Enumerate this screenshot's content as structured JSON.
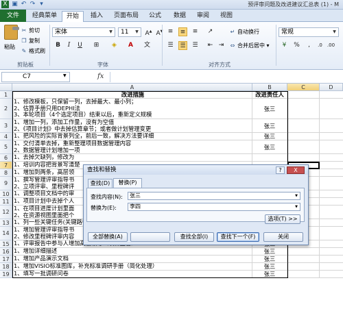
{
  "window": {
    "title": "预评审问题及改进建议汇总表 (1) - M"
  },
  "ribbon": {
    "tabs": [
      "文件",
      "经典菜单",
      "开始",
      "插入",
      "页面布局",
      "公式",
      "数据",
      "审阅",
      "视图"
    ],
    "active_tab": "开始",
    "clipboard": {
      "paste": "粘贴",
      "cut": "剪切",
      "copy": "复制",
      "format_painter": "格式刷",
      "group_label": "剪贴板"
    },
    "font": {
      "font_name": "宋体",
      "font_size": "11",
      "group_label": "字体"
    },
    "alignment": {
      "wrap_text": "自动换行",
      "merge_center": "合并后居中",
      "group_label": "对齐方式"
    },
    "number": {
      "format": "常规"
    }
  },
  "formula_bar": {
    "name_box": "C7",
    "fx": "fx",
    "content": ""
  },
  "grid": {
    "columns": [
      "A",
      "B",
      "C",
      "D"
    ],
    "header_row": {
      "num": "1",
      "a": "改进措施",
      "b": "改进责任人"
    },
    "rows": [
      {
        "num": "2",
        "lines": [
          "1、修改模板，只保留一列，去掉最大、最小列；",
          "2、估算手册只用DEPHI法",
          "3、本轮项目（4个选定项目）结束以后，重新定义规模"
        ],
        "b": "张三"
      },
      {
        "num": "3",
        "lines": [
          "1、增加一列，添加工作量，没有为空值",
          "2、《项目计划》中去掉估算章节；或者做计划管理变更"
        ],
        "b": "张三"
      },
      {
        "num": "4",
        "lines": [
          "1、把风险的实际背景列全，前后一致，解决方法要详细"
        ],
        "b": "张三"
      },
      {
        "num": "5",
        "lines": [
          "1、交付清单去掉，重新整理项目数据管理内容",
          "2、数据管理计划增加一项"
        ],
        "b": "张三"
      },
      {
        "num": "6",
        "lines": [
          "1、去掉欠缺列，修改为"
        ],
        "b": ""
      },
      {
        "num": "7",
        "lines": [
          "1、培训内容把背景写清楚"
        ],
        "b": ""
      },
      {
        "num": "8",
        "lines": [
          "1、增加到两条，高层领"
        ],
        "b": ""
      },
      {
        "num": "9",
        "lines": [
          "1、撰写管理评审指导书",
          "2、立项评审、里程碑评"
        ],
        "b": ""
      },
      {
        "num": "10",
        "lines": [
          "1、调整项目文档中的审"
        ],
        "b": ""
      },
      {
        "num": "11",
        "lines": [
          "1、项目计划中去掉个人"
        ],
        "b": ""
      },
      {
        "num": "12",
        "lines": [
          "1、在项目进度计划里面",
          "2、在资源视图里面把个"
        ],
        "b": ""
      },
      {
        "num": "13",
        "lines": [
          "1、列一些关键任务(关键路径上的任务)"
        ],
        "b": "张三"
      },
      {
        "num": "14",
        "lines": [
          "1、增加管理评审指导书",
          "2、修改里程碑评审内容"
        ],
        "b": "张三"
      },
      {
        "num": "15",
        "lines": [
          "1、评审报告中参与人增加高层领导（项目主管）"
        ],
        "b": "张三"
      },
      {
        "num": "16",
        "lines": [
          "1、增加详细描述"
        ],
        "b": "张三"
      },
      {
        "num": "17",
        "lines": [
          "1、增加产品演示文档"
        ],
        "b": "张三"
      },
      {
        "num": "18",
        "lines": [
          "1、增加VISIO标准图库，补充标准调研手册（简化处理）"
        ],
        "b": "张三"
      },
      {
        "num": "19",
        "lines": [
          "1、填写一批调研问卷"
        ],
        "b": "张三"
      }
    ]
  },
  "dialog": {
    "title": "查找和替换",
    "help": "?",
    "close": "X",
    "tabs": [
      "查找(D)",
      "替换(P)"
    ],
    "active_tab": "替换(P)",
    "find_label": "查找内容(N):",
    "find_value": "张三",
    "replace_label": "替换为(E):",
    "replace_value": "李四",
    "options_button": "选项(T) >>",
    "buttons": {
      "replace_all": "全部替换(A)",
      "replace": "",
      "find_all": "查找全部(I)",
      "find_next": "查找下一个(F)",
      "close": "关闭"
    }
  }
}
